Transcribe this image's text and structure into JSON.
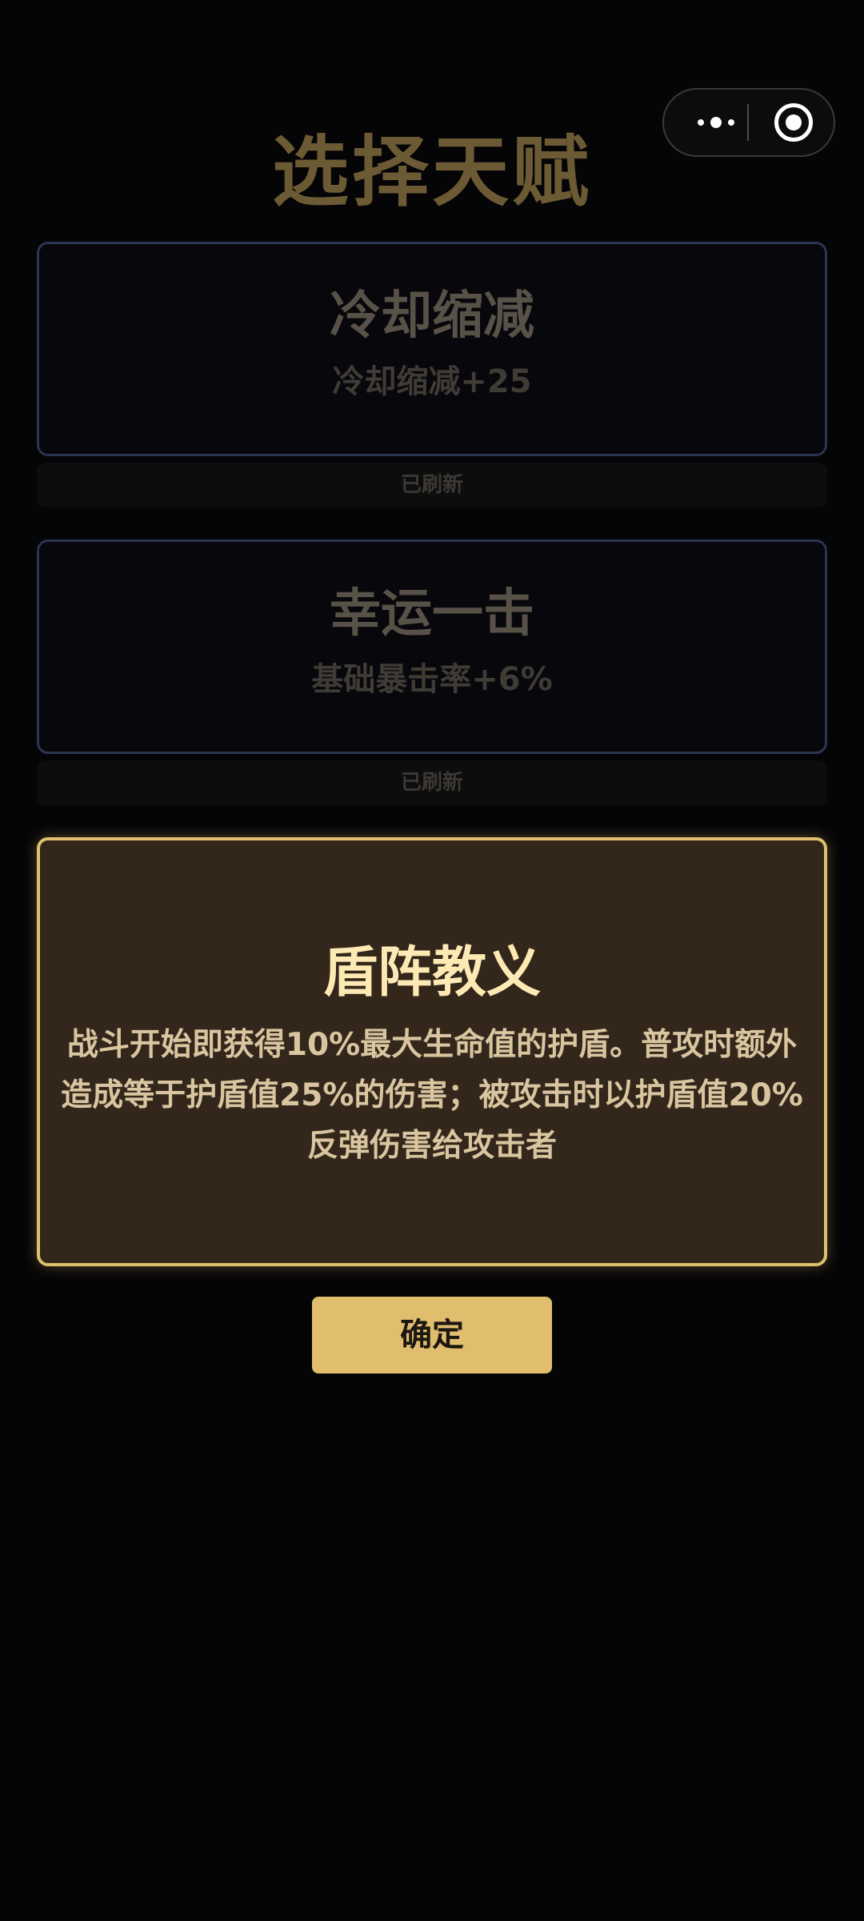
{
  "page": {
    "title": "选择天赋"
  },
  "capsule": {
    "more_icon": "more-dots-icon",
    "close_icon": "target-close-icon"
  },
  "talents": [
    {
      "name": "冷却缩减",
      "description": "冷却缩减+25",
      "status": "已刷新",
      "state": "dimmed"
    },
    {
      "name": "幸运一击",
      "description": "基础暴击率+6%",
      "status": "已刷新",
      "state": "dimmed"
    },
    {
      "name": "盾阵教义",
      "description": "战斗开始即获得10%最大生命值的护盾。普攻时额外造成等于护盾值25%的伤害；被攻击时以护盾值20%反弹伤害给攻击者",
      "state": "selected"
    }
  ],
  "actions": {
    "confirm_label": "确定"
  },
  "colors": {
    "background": "#050406",
    "title": "#6b5a33",
    "accent_gold": "#e0be6d",
    "dim_card_border": "#2a3550",
    "selected_card_bg": "#33261b"
  }
}
